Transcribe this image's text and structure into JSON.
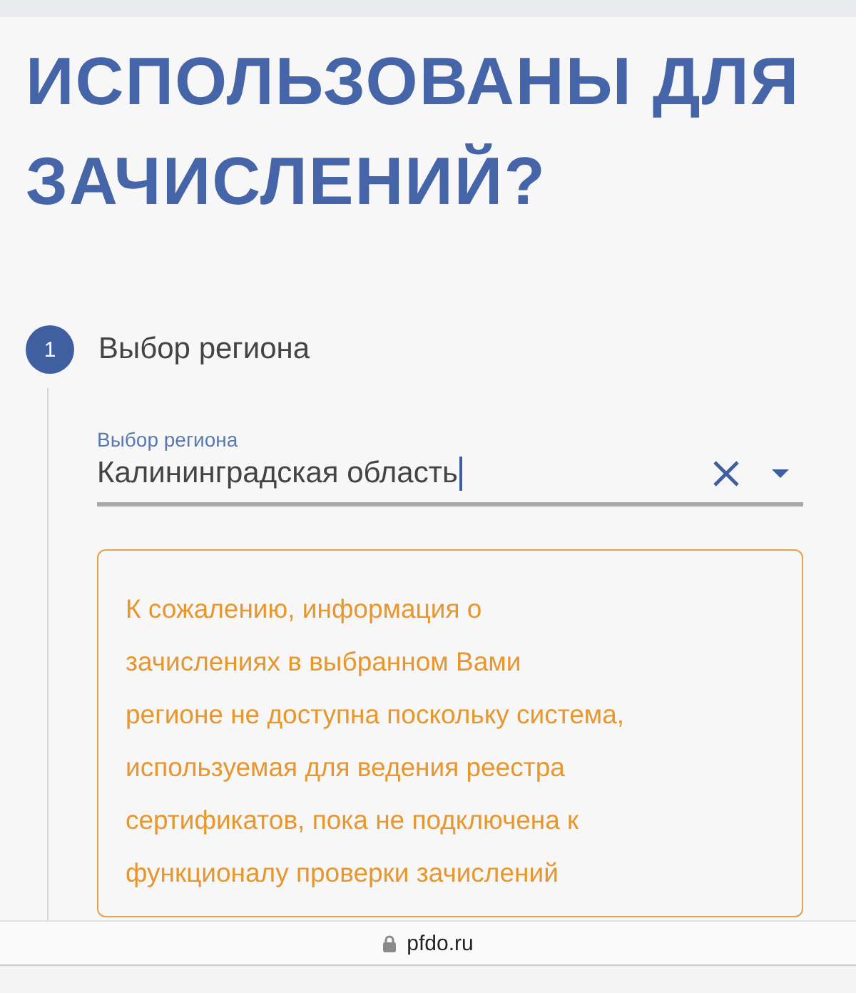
{
  "heading": "ИСПОЛЬЗОВАНЫ ДЛЯ ЗАЧИСЛЕНИЙ?",
  "steps": [
    {
      "number": "1",
      "title": "Выбор региона",
      "field": {
        "label": "Выбор региона",
        "value": "Калининградская область",
        "focused": true
      },
      "alert": {
        "kind": "warning",
        "text": "К сожалению, информация о\nзачислениях в выбранном Вами\nрегионе не доступна поскольку система,\nиспользуемая для ведения реестра\nсертификатов, пока не подключена к\nфункционалу проверки зачислений"
      }
    }
  ],
  "address_bar": {
    "url": "pfdo.ru",
    "secure": true
  }
}
